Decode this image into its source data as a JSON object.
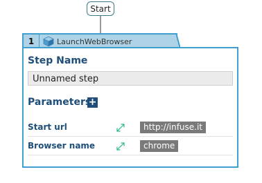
{
  "start_node": {
    "label": "Start"
  },
  "step": {
    "number": "1",
    "type_label": "LaunchWebBrowser",
    "type_icon": "cube-icon",
    "step_name_title": "Step Name",
    "step_name_value": "Unnamed step",
    "parameters_title": "Parameters",
    "add_parameter_label": "+",
    "parameters": [
      {
        "label": "Start url",
        "value": "http://infuse.it",
        "link_icon": "expand-link-icon"
      },
      {
        "label": "Browser name",
        "value": "chrome",
        "link_icon": "expand-link-icon"
      }
    ]
  },
  "colors": {
    "accent_border": "#3fa0cf",
    "tab_background": "#aed3e6",
    "title_text": "#1e4e79",
    "value_chip": "#7a7a7a",
    "link_icon": "#2db58a"
  }
}
